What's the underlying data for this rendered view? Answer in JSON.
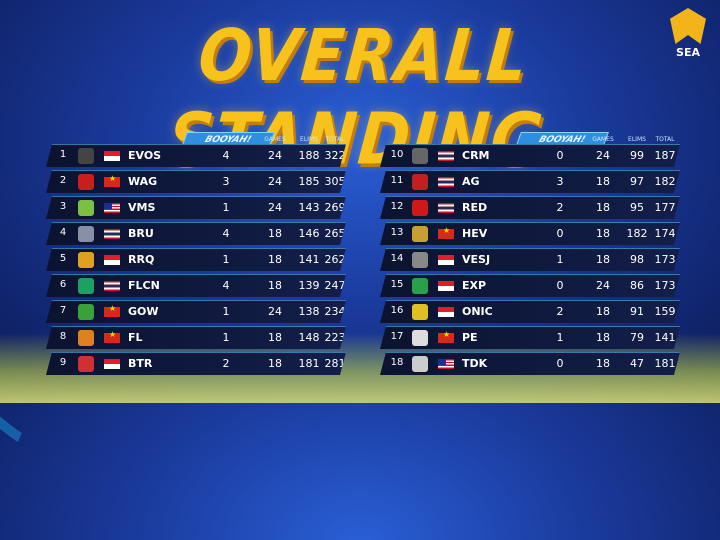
{
  "title": "OVERALL STANDING",
  "logo_text": "SEA",
  "headers": {
    "booyah": "BOOYAH!",
    "games": "GAMES",
    "elims": "ELIMS",
    "total": "TOTAL"
  },
  "left_table": [
    {
      "rank": "1",
      "team": "EVOS",
      "flag": "id",
      "booyah": "4",
      "games": "24",
      "elims": "188",
      "total": "322",
      "icon_color": "#444"
    },
    {
      "rank": "2",
      "team": "WAG",
      "flag": "vn",
      "booyah": "3",
      "games": "24",
      "elims": "185",
      "total": "305",
      "icon_color": "#c81e1e"
    },
    {
      "rank": "3",
      "team": "VMS",
      "flag": "my",
      "booyah": "1",
      "games": "24",
      "elims": "143",
      "total": "269",
      "icon_color": "#7bc043"
    },
    {
      "rank": "4",
      "team": "BRU",
      "flag": "th",
      "booyah": "4",
      "games": "18",
      "elims": "146",
      "total": "265",
      "icon_color": "#8a8fa8"
    },
    {
      "rank": "5",
      "team": "RRQ",
      "flag": "id",
      "booyah": "1",
      "games": "18",
      "elims": "141",
      "total": "262",
      "icon_color": "#e0a020"
    },
    {
      "rank": "6",
      "team": "FLCN",
      "flag": "th",
      "booyah": "4",
      "games": "18",
      "elims": "139",
      "total": "247",
      "icon_color": "#20a060"
    },
    {
      "rank": "7",
      "team": "GOW",
      "flag": "vn",
      "booyah": "1",
      "games": "24",
      "elims": "138",
      "total": "234",
      "icon_color": "#3aa03a"
    },
    {
      "rank": "8",
      "team": "FL",
      "flag": "vn",
      "booyah": "1",
      "games": "18",
      "elims": "148",
      "total": "223",
      "icon_color": "#e08020"
    },
    {
      "rank": "9",
      "team": "BTR",
      "flag": "id",
      "booyah": "2",
      "games": "18",
      "elims": "181",
      "total": "281",
      "icon_color": "#d03030"
    }
  ],
  "right_table": [
    {
      "rank": "10",
      "team": "CRM",
      "flag": "th",
      "booyah": "0",
      "games": "24",
      "elims": "99",
      "total": "187",
      "icon_color": "#666"
    },
    {
      "rank": "11",
      "team": "AG",
      "flag": "th",
      "booyah": "3",
      "games": "18",
      "elims": "97",
      "total": "182",
      "icon_color": "#c02020"
    },
    {
      "rank": "12",
      "team": "RED",
      "flag": "th",
      "booyah": "2",
      "games": "18",
      "elims": "95",
      "total": "177",
      "icon_color": "#d01818"
    },
    {
      "rank": "13",
      "team": "HEV",
      "flag": "vn",
      "booyah": "0",
      "games": "18",
      "elims": "182",
      "total": "174",
      "icon_color": "#c8a030"
    },
    {
      "rank": "14",
      "team": "VESJ",
      "flag": "id",
      "booyah": "1",
      "games": "18",
      "elims": "98",
      "total": "173",
      "icon_color": "#888"
    },
    {
      "rank": "15",
      "team": "EXP",
      "flag": "id",
      "booyah": "0",
      "games": "24",
      "elims": "86",
      "total": "173",
      "icon_color": "#2aa04a"
    },
    {
      "rank": "16",
      "team": "ONIC",
      "flag": "id",
      "booyah": "2",
      "games": "18",
      "elims": "91",
      "total": "159",
      "icon_color": "#e0c020"
    },
    {
      "rank": "17",
      "team": "PE",
      "flag": "vn",
      "booyah": "1",
      "games": "18",
      "elims": "79",
      "total": "141",
      "icon_color": "#ddd"
    },
    {
      "rank": "18",
      "team": "TDK",
      "flag": "my",
      "booyah": "0",
      "games": "18",
      "elims": "47",
      "total": "181",
      "icon_color": "#ccc"
    }
  ]
}
